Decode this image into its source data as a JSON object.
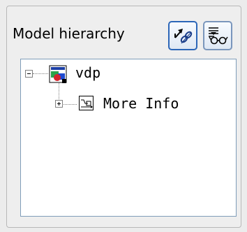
{
  "panel": {
    "title": "Model hierarchy",
    "toolbar": [
      {
        "name": "link-to-model",
        "icon": "link-arrow-icon"
      },
      {
        "name": "filter-view",
        "icon": "filter-glasses-icon"
      }
    ]
  },
  "tree": {
    "root": {
      "label": "vdp",
      "icon": "simulink-model-icon",
      "expanded": true,
      "children": [
        {
          "label": "More Info",
          "icon": "subsystem-icon",
          "expanded": false
        }
      ]
    }
  },
  "colors": {
    "button_border": "#2c66b8",
    "tree_border": "#7f9db9",
    "tree_bg": "#ffffff"
  }
}
